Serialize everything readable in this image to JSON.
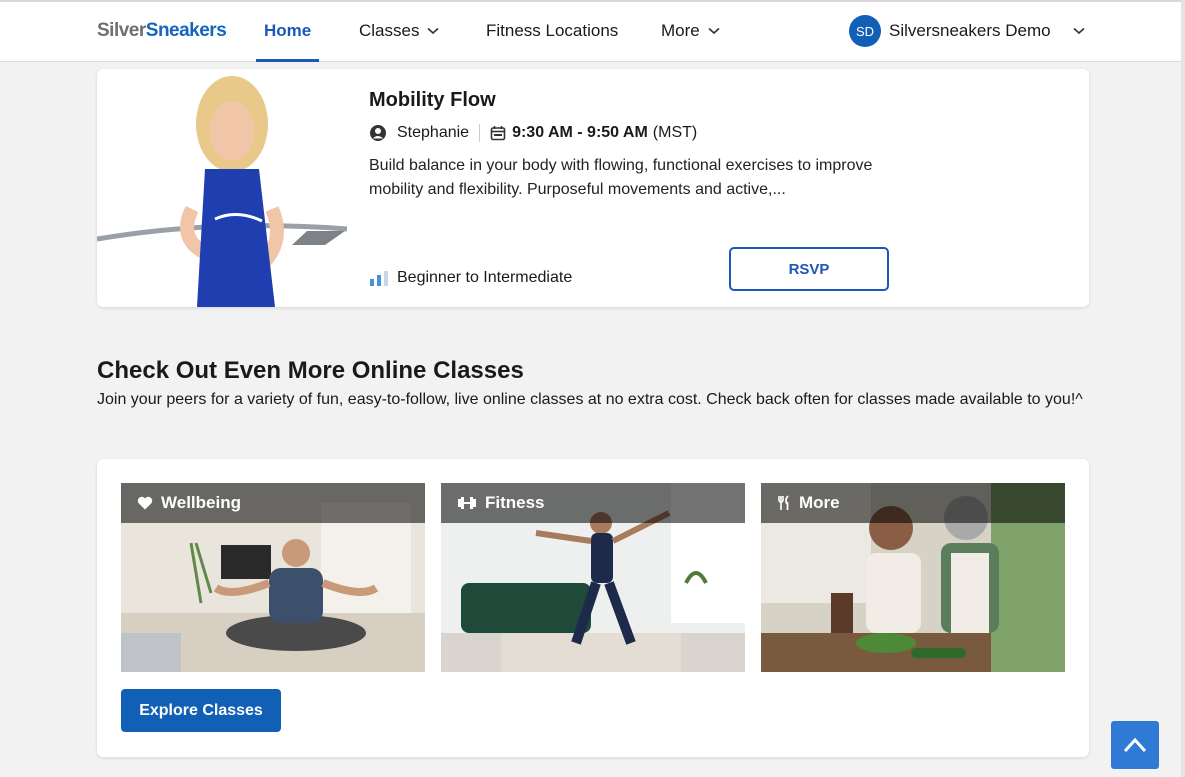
{
  "header": {
    "logo_part1": "Silver",
    "logo_part2": "Sneakers",
    "nav": {
      "home": "Home",
      "classes": "Classes",
      "fitness_locations": "Fitness Locations",
      "more": "More"
    },
    "user": {
      "initials": "SD",
      "name": "Silversneakers Demo"
    }
  },
  "class_card": {
    "title": "Mobility Flow",
    "instructor": "Stephanie",
    "time": "9:30 AM - 9:50 AM",
    "timezone": "(MST)",
    "description": "Build balance in your body with flowing, functional exercises to improve mobility and flexibility. Purposeful movements and active,...",
    "level": "Beginner to Intermediate",
    "rsvp_label": "RSVP"
  },
  "online_section": {
    "title": "Check Out Even More Online Classes",
    "description": "Join your peers for a variety of fun, easy-to-follow, live online classes at no extra cost. Check back often for classes made available to you!^",
    "categories": [
      {
        "label": "Wellbeing",
        "icon": "heart-icon"
      },
      {
        "label": "Fitness",
        "icon": "dumbbell-icon"
      },
      {
        "label": "More",
        "icon": "utensils-icon"
      }
    ],
    "explore_label": "Explore Classes"
  },
  "colors": {
    "brand_blue": "#1d57b8",
    "button_blue": "#1160b6",
    "back_to_top": "#2f7ad4"
  }
}
